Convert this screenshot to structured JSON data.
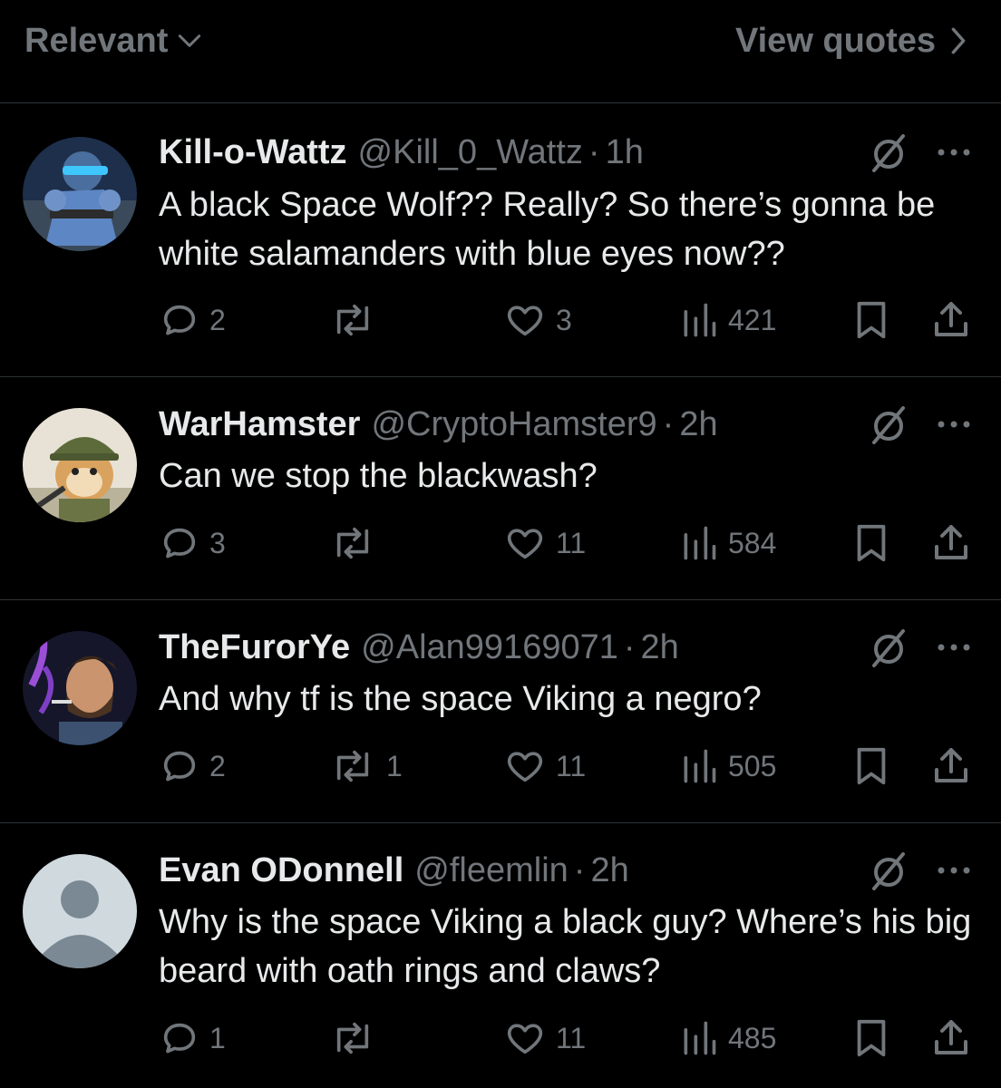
{
  "header": {
    "sort_label": "Relevant",
    "view_quotes_label": "View quotes",
    "sort_icon": "chevron-down-icon",
    "view_quotes_icon": "chevron-right-icon"
  },
  "colors": {
    "background": "#000000",
    "primary_text": "#e7e9ea",
    "secondary_text": "#71767b",
    "divider": "#2f3336"
  },
  "replies": [
    {
      "name": "Kill-o-Wattz",
      "handle": "@Kill_0_Wattz",
      "separator": "·",
      "time": "1h",
      "text": "A black Space Wolf?? Really? So there’s gonna be white salamanders with blue eyes now??",
      "replies": "2",
      "reposts": "",
      "likes": "3",
      "views": "421",
      "avatar": "armored-soldier-avatar"
    },
    {
      "name": "WarHamster",
      "handle": "@CryptoHamster9",
      "separator": "·",
      "time": "2h",
      "text": "Can we stop the blackwash?",
      "replies": "3",
      "reposts": "",
      "likes": "11",
      "views": "584",
      "avatar": "hamster-soldier-avatar"
    },
    {
      "name": "TheFurorYe",
      "handle": "@Alan99169071",
      "separator": "·",
      "time": "2h",
      "text": "And why tf is the space Viking a negro?",
      "replies": "2",
      "reposts": "1",
      "likes": "11",
      "views": "505",
      "avatar": "smoking-man-avatar"
    },
    {
      "name": "Evan ODonnell",
      "handle": "@fleemlin",
      "separator": "·",
      "time": "2h",
      "text": "Why is the space Viking a black guy? Where’s his big beard with oath rings and claws?",
      "replies": "1",
      "reposts": "",
      "likes": "11",
      "views": "485",
      "avatar": "default-user-avatar"
    }
  ]
}
